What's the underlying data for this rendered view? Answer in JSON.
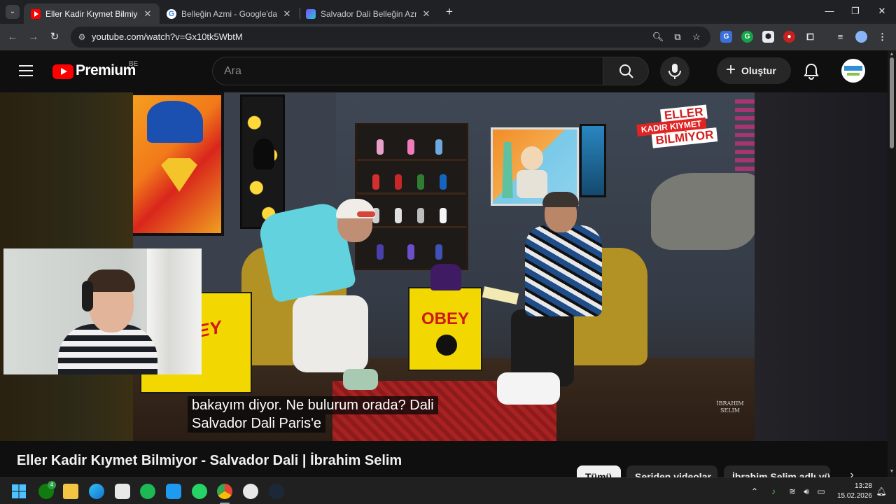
{
  "browser": {
    "tabs": [
      {
        "title": "Eller Kadir Kıymet Bilmiyor - Sal",
        "active": true,
        "favicon_color": "#ff0000"
      },
      {
        "title": "Belleğin Azmi - Google'da Ara",
        "active": false,
        "favicon_color": "#4285f4"
      },
      {
        "title": "Salvador Dali Belleğin Azmi Tab",
        "active": false,
        "favicon_color": "#5c6bc0"
      }
    ],
    "url": "youtube.com/watch?v=Gx10tk5WbtM"
  },
  "youtube": {
    "brand": "Premium",
    "country_code": "BE",
    "search_placeholder": "Ara",
    "create_label": "Oluştur"
  },
  "video": {
    "overlay_logo": {
      "line1": "ELLER",
      "line2": "KADIR KIYMET",
      "line3": "BİLMİYOR"
    },
    "box_label_1": "OBEY",
    "box_label_2": "OBEY",
    "captions": [
      "bakayım diyor. Ne bulurum orada? Dali",
      "Salvador Dali Paris'e"
    ],
    "watermark": "İBRAHIM SELIM"
  },
  "page": {
    "video_title": "Eller Kadir Kıymet Bilmiyor - Salvador Dali | İbrahim Selim",
    "chips": [
      {
        "label": "Tümü",
        "selected": true
      },
      {
        "label": "Seriden videolar",
        "selected": false
      },
      {
        "label": "İbrahim Selim adlı yükleyicid",
        "selected": false
      }
    ]
  },
  "taskbar": {
    "xbox_badge": "4",
    "time": "13:28",
    "date": "15.02.2026"
  },
  "colors": {
    "youtube_red": "#ff0000",
    "bg_dark": "#0f0f0f",
    "chrome_tabstrip": "#202124",
    "chrome_toolbar": "#35363a"
  }
}
